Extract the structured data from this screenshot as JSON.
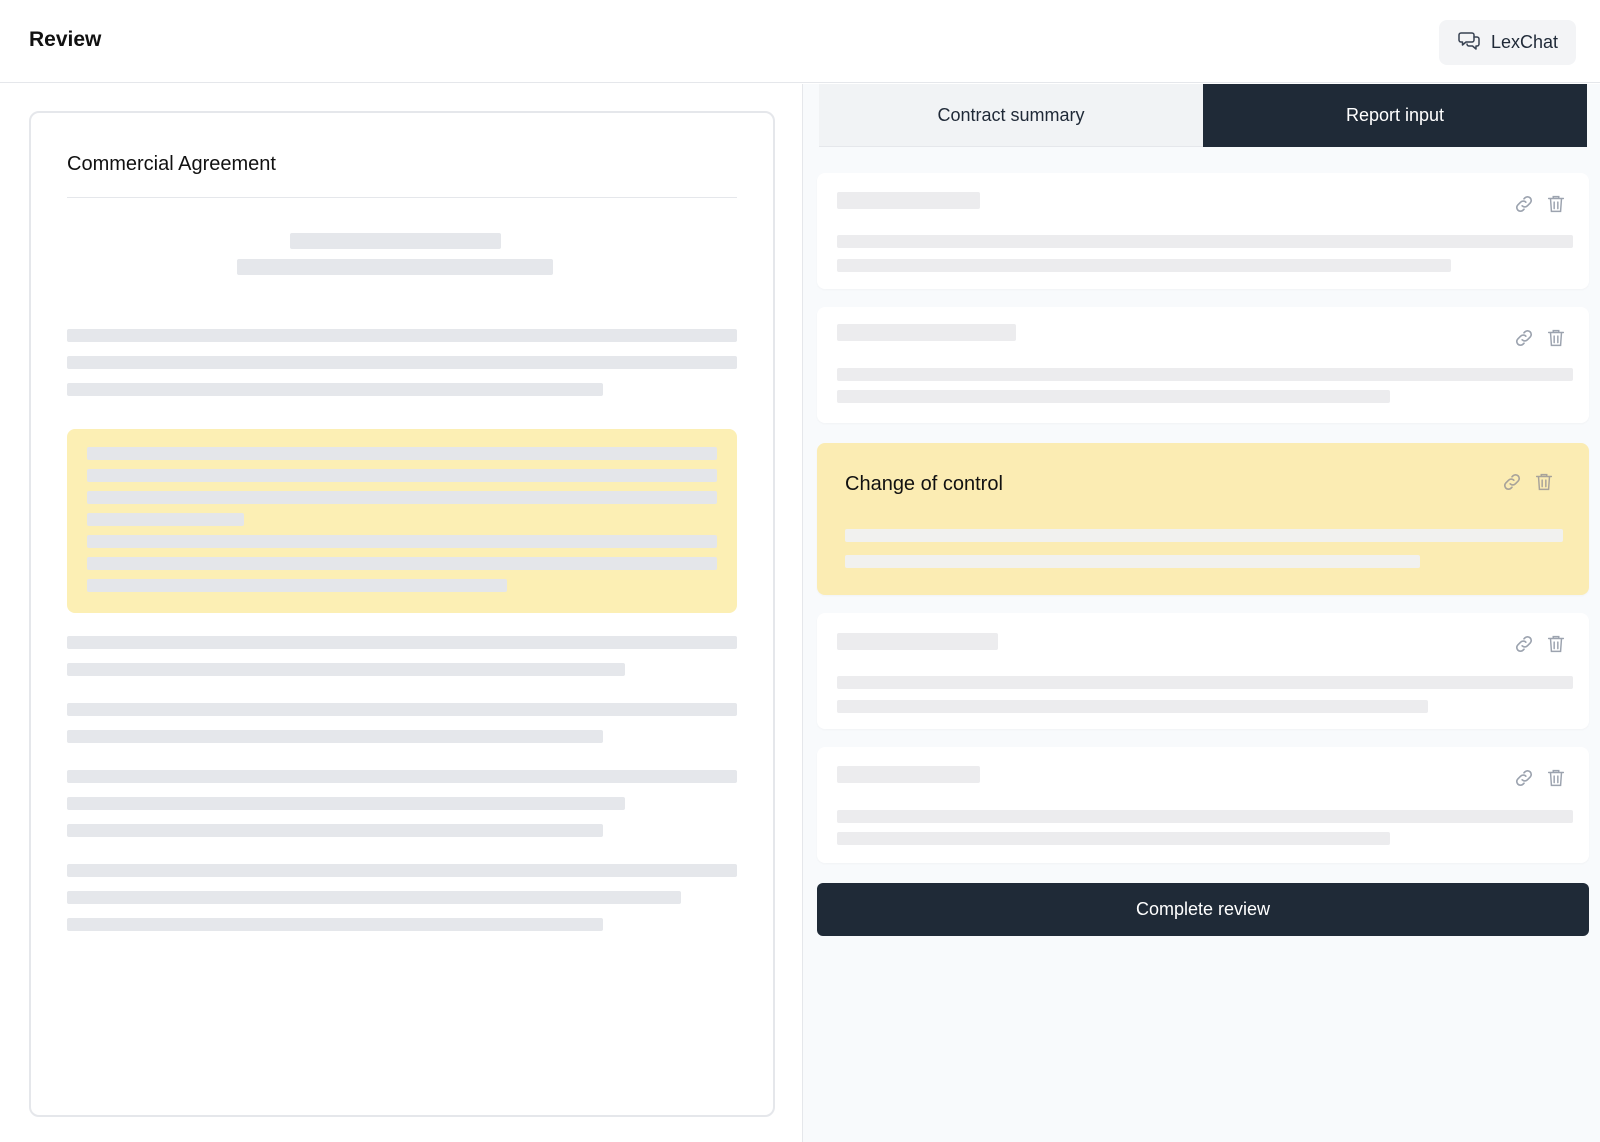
{
  "header": {
    "title": "Review",
    "lexchat_label": "LexChat"
  },
  "document": {
    "title": "Commercial Agreement"
  },
  "tabs": [
    {
      "label": "Contract summary",
      "active": false
    },
    {
      "label": "Report input",
      "active": true
    }
  ],
  "report_items": [
    {
      "title": "",
      "highlighted": false
    },
    {
      "title": "",
      "highlighted": false
    },
    {
      "title": "Change of control",
      "highlighted": true
    },
    {
      "title": "",
      "highlighted": false
    },
    {
      "title": "",
      "highlighted": false
    }
  ],
  "actions": {
    "complete_label": "Complete review"
  },
  "colors": {
    "primary_dark": "#1f2a37",
    "highlight": "#fcefb4",
    "placeholder": "#e5e7eb"
  }
}
